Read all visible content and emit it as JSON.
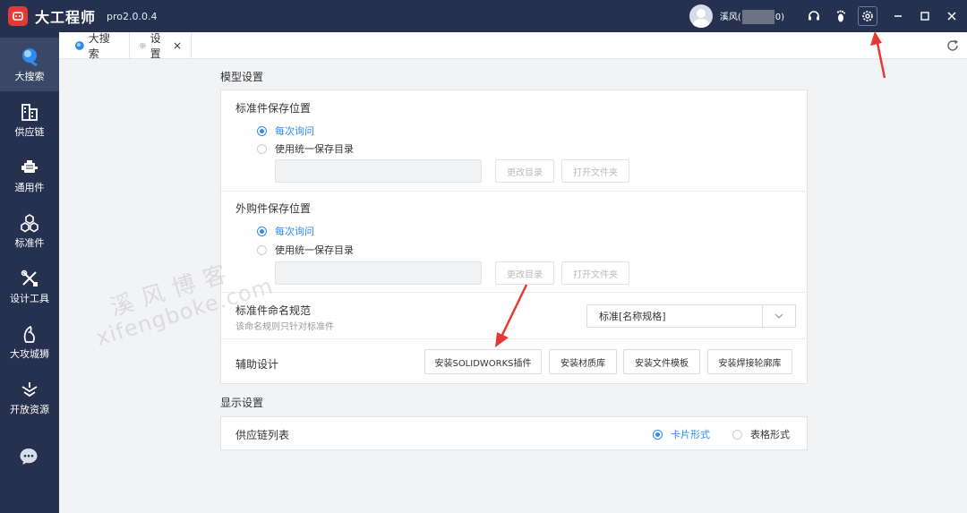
{
  "app": {
    "name": "大工程师",
    "version": "pro2.0.0.4",
    "user_prefix": "溪风(",
    "user_suffix": "0)"
  },
  "sidebar": {
    "items": [
      {
        "label": "大搜索",
        "icon": "search-icon"
      },
      {
        "label": "供应链",
        "icon": "buildings-icon"
      },
      {
        "label": "通用件",
        "icon": "motor-icon"
      },
      {
        "label": "标准件",
        "icon": "hexagons-icon"
      },
      {
        "label": "设计工具",
        "icon": "tools-icon"
      },
      {
        "label": "大攻城狮",
        "icon": "lion-icon"
      },
      {
        "label": "开放资源",
        "icon": "open-resource-icon"
      }
    ],
    "chat_icon": "chat-icon"
  },
  "tabs": [
    {
      "label": "大搜索"
    },
    {
      "label": "设置",
      "close": "×"
    }
  ],
  "model_settings": {
    "title": "模型设置",
    "std_save": {
      "title": "标准件保存位置",
      "option_ask": "每次询问",
      "option_unified": "使用统一保存目录",
      "path_value": "",
      "change_dir": "更改目录",
      "open_folder": "打开文件夹"
    },
    "purchased_save": {
      "title": "外购件保存位置",
      "option_ask": "每次询问",
      "option_unified": "使用统一保存目录",
      "path_value": "",
      "change_dir": "更改目录",
      "open_folder": "打开文件夹"
    },
    "naming": {
      "title": "标准件命名规范",
      "subtitle": "该命名规则只针对标准件",
      "selected": "标准[名称规格]"
    },
    "aux": {
      "title": "辅助设计",
      "buttons": [
        "安装SOLIDWORKS插件",
        "安装材质库",
        "安装文件模板",
        "安装焊接轮廓库"
      ]
    }
  },
  "display_settings": {
    "title": "显示设置",
    "supply_list": {
      "title": "供应链列表",
      "option_card": "卡片形式",
      "option_table": "表格形式"
    }
  },
  "watermark": {
    "line1": "溪风博客",
    "line2": "xifengboke.com"
  },
  "colors": {
    "accent": "#2d8cf0",
    "sidebar_bg": "#263150",
    "annotation": "#e53935"
  }
}
